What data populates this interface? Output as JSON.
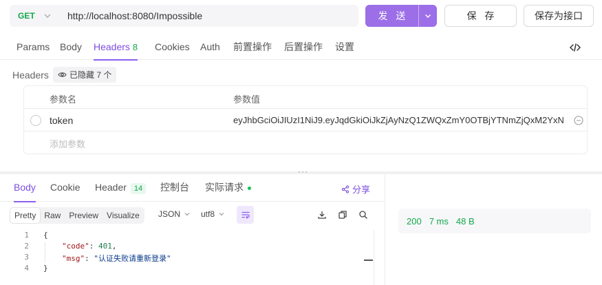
{
  "request": {
    "method": "GET",
    "url": "http://localhost:8080/Impossible",
    "send_label": "发 送",
    "save_label": "保 存",
    "save_as_api_label": "保存为接口"
  },
  "request_tabs": [
    {
      "label": "Params"
    },
    {
      "label": "Body"
    },
    {
      "label": "Headers",
      "count": "8"
    },
    {
      "label": "Cookies"
    },
    {
      "label": "Auth"
    },
    {
      "label": "前置操作"
    },
    {
      "label": "后置操作"
    },
    {
      "label": "设置"
    }
  ],
  "headers": {
    "section_label": "Headers",
    "hidden_badge": "已隐藏 7 个",
    "col_name": "参数名",
    "col_value": "参数值",
    "rows": [
      {
        "name": "token",
        "value": "eyJhbGciOiJIUzI1NiJ9.eyJqdGkiOiJkZjAyNzQ1ZWQxZmY0OTBjYTNmZjQxM2YxN"
      }
    ],
    "add_placeholder": "添加参数"
  },
  "response_tabs": [
    {
      "label": "Body"
    },
    {
      "label": "Cookie"
    },
    {
      "label": "Header",
      "count": "14"
    },
    {
      "label": "控制台"
    },
    {
      "label": "实际请求"
    }
  ],
  "share_label": "分享",
  "body_toolbar": {
    "formats": [
      "Pretty",
      "Raw",
      "Preview",
      "Visualize"
    ],
    "language": "JSON",
    "encoding": "utf8"
  },
  "code": {
    "line_numbers": [
      "1",
      "2",
      "3",
      "4"
    ],
    "open_brace": "{",
    "close_brace": "}",
    "code_key": "\"code\"",
    "code_value": "401",
    "msg_key": "\"msg\"",
    "msg_value": "\"认证失败请重新登录\""
  },
  "status": {
    "code": "200",
    "time": "7 ms",
    "size": "48 B"
  },
  "colors": {
    "accent": "#8d5ef0",
    "success": "#12a84a"
  }
}
